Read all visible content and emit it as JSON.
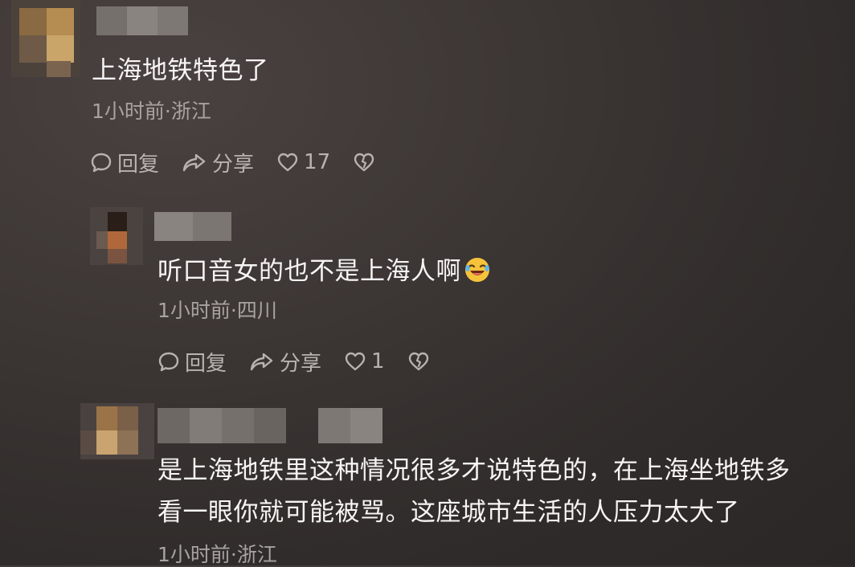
{
  "comments": [
    {
      "text": "上海地铁特色了",
      "meta": "1小时前·浙江",
      "reply_label": "回复",
      "share_label": "分享",
      "like_count": "17",
      "icons": [
        "comment-bubble-icon",
        "share-arrow-icon",
        "heart-icon",
        "broken-heart-icon"
      ]
    },
    {
      "text": "听口音女的也不是上海人啊",
      "emoji": "laughing-crying-emoji",
      "meta": "1小时前·四川",
      "reply_label": "回复",
      "share_label": "分享",
      "like_count": "1",
      "icons": [
        "comment-bubble-icon",
        "share-arrow-icon",
        "heart-icon",
        "broken-heart-icon"
      ]
    },
    {
      "text_line1": "是上海地铁里这种情况很多才说特色的，在上海坐地铁多",
      "text_line2": "看一眼你就可能被骂。这座城市生活的人压力太大了",
      "meta": "1小时前·浙江"
    }
  ],
  "colors": {
    "background": "#3a3432",
    "text": "#f7f5f4",
    "meta": "#a8a2a0",
    "action": "#b8b2b0"
  }
}
